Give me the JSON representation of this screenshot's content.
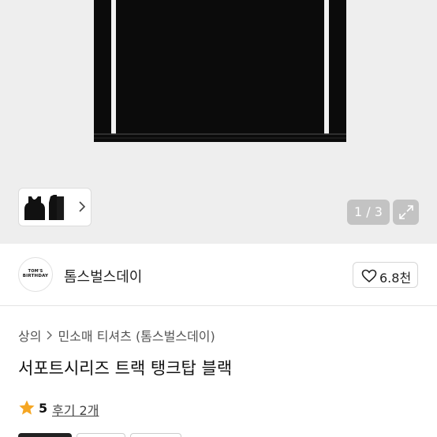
{
  "gallery": {
    "counter": "1 / 3",
    "thumbnail_count": 2
  },
  "seller": {
    "logo_line1": "TOM'S",
    "logo_line2": "BIRTHDAY",
    "name": "톰스벌스데이",
    "likes": "6.8천"
  },
  "breadcrumb": [
    "상의",
    "민소매 티셔츠 (톰스벌스데이)"
  ],
  "product": {
    "title": "서포트시리즈 트랙 탱크탑 블랙",
    "rating": "5",
    "reviews_label": "후기 2개"
  },
  "colors": {
    "star": "#f5a623",
    "background_gray": "#eeeeee"
  }
}
